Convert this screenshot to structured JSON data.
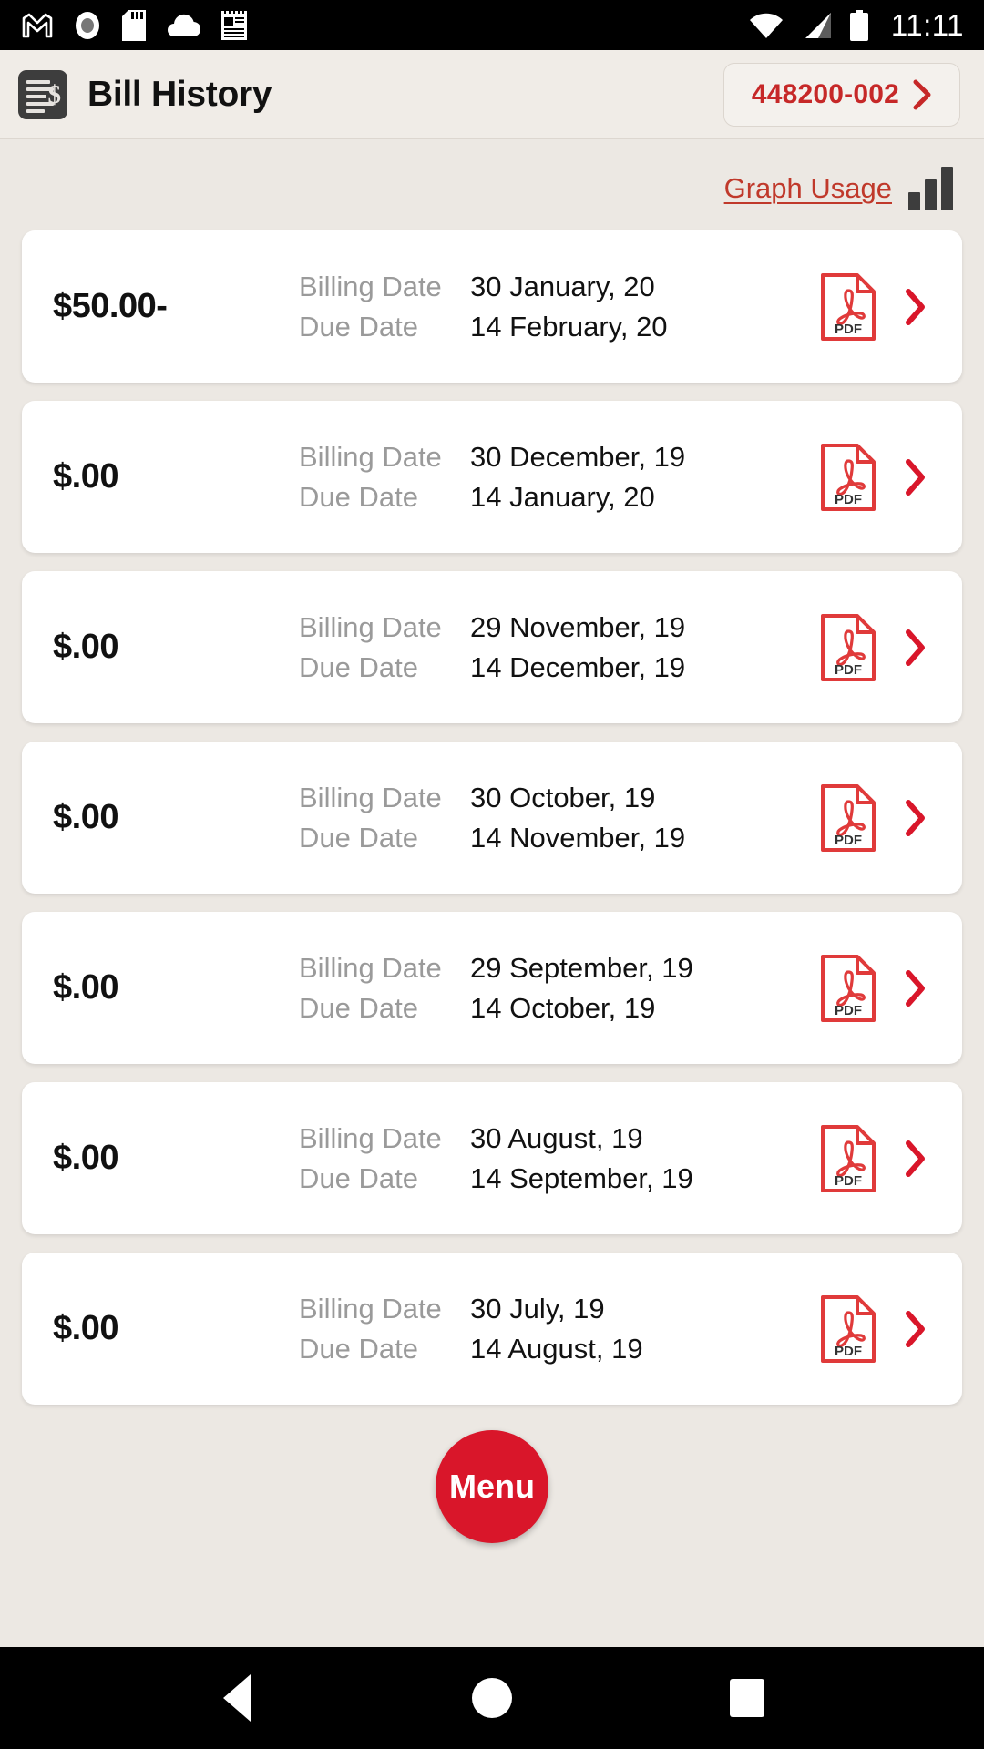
{
  "statusbar": {
    "icons": [
      "gmail-icon",
      "record-icon",
      "sd-card-icon",
      "cloud-icon",
      "notepad-icon"
    ],
    "wifi_icon": "wifi-icon",
    "signal_icon": "cell-signal-icon",
    "battery_icon": "battery-icon",
    "time": "11:11"
  },
  "header": {
    "icon": "bill-document-icon",
    "title": "Bill History",
    "account_number": "448200-002",
    "account_chevron": "chevron-right-icon"
  },
  "toolbar": {
    "graph_usage_label": "Graph Usage",
    "graph_icon": "bar-chart-icon"
  },
  "labels": {
    "billing_date": "Billing Date",
    "due_date": "Due Date",
    "pdf_icon": "pdf-file-icon",
    "pdf_text": "PDF",
    "row_chevron": "chevron-right-icon"
  },
  "bills": [
    {
      "amount": "$50.00-",
      "billing_date": "30 January, 20",
      "due_date": "14 February, 20"
    },
    {
      "amount": "$.00",
      "billing_date": "30 December, 19",
      "due_date": "14 January, 20"
    },
    {
      "amount": "$.00",
      "billing_date": "29 November, 19",
      "due_date": "14 December, 19"
    },
    {
      "amount": "$.00",
      "billing_date": "30 October, 19",
      "due_date": "14 November, 19"
    },
    {
      "amount": "$.00",
      "billing_date": "29 September, 19",
      "due_date": "14 October, 19"
    },
    {
      "amount": "$.00",
      "billing_date": "30 August, 19",
      "due_date": "14 September, 19"
    },
    {
      "amount": "$.00",
      "billing_date": "30 July, 19",
      "due_date": "14 August, 19"
    }
  ],
  "fab": {
    "label": "Menu"
  },
  "navbar": {
    "back": "back-nav-icon",
    "home": "home-nav-icon",
    "recents": "recents-nav-icon"
  },
  "colors": {
    "accent_red": "#c62828",
    "fab_red": "#d9162a",
    "background": "#ece8e3",
    "card": "#ffffff",
    "muted_label": "#9a9a9a"
  }
}
